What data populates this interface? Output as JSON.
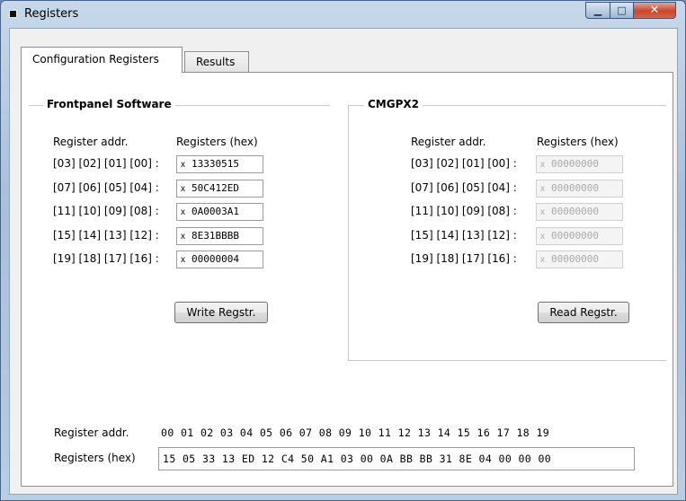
{
  "window": {
    "title": "Registers"
  },
  "tabs": [
    {
      "label": "Configuration Registers"
    },
    {
      "label": "Results"
    }
  ],
  "frontpanel": {
    "title": "Frontpanel Software",
    "col_addr": "Register addr.",
    "col_regs": "Registers (hex)",
    "rows": [
      {
        "addr": "[03] [02] [01] [00] :",
        "prefix": "x",
        "value": "13330515"
      },
      {
        "addr": "[07] [06] [05] [04] :",
        "prefix": "x",
        "value": "50C412ED"
      },
      {
        "addr": "[11] [10] [09] [08] :",
        "prefix": "x",
        "value": "0A0003A1"
      },
      {
        "addr": "[15] [14] [13] [12] :",
        "prefix": "x",
        "value": "8E31BBBB"
      },
      {
        "addr": "[19] [18] [17] [16] :",
        "prefix": "x",
        "value": "00000004"
      }
    ],
    "button": "Write Regstr."
  },
  "cmgpx2": {
    "title": "CMGPX2",
    "col_addr": "Register addr.",
    "col_regs": "Registers (hex)",
    "rows": [
      {
        "addr": "[03] [02] [01] [00] :",
        "prefix": "x",
        "value": "00000000"
      },
      {
        "addr": "[07] [06] [05] [04] :",
        "prefix": "x",
        "value": "00000000"
      },
      {
        "addr": "[11] [10] [09] [08] :",
        "prefix": "x",
        "value": "00000000"
      },
      {
        "addr": "[15] [14] [13] [12] :",
        "prefix": "x",
        "value": "00000000"
      },
      {
        "addr": "[19] [18] [17] [16] :",
        "prefix": "x",
        "value": "00000000"
      }
    ],
    "button": "Read Regstr."
  },
  "bottom": {
    "addr_label": "Register addr.",
    "addr_values": "00 01 02 03 04 05 06 07 08 09 10 11 12 13 14 15 16 17 18 19",
    "regs_label": "Registers (hex)",
    "regs_values": "15 05 33 13 ED 12 C4 50 A1 03 00 0A BB BB 31 8E 04 00 00 00"
  }
}
